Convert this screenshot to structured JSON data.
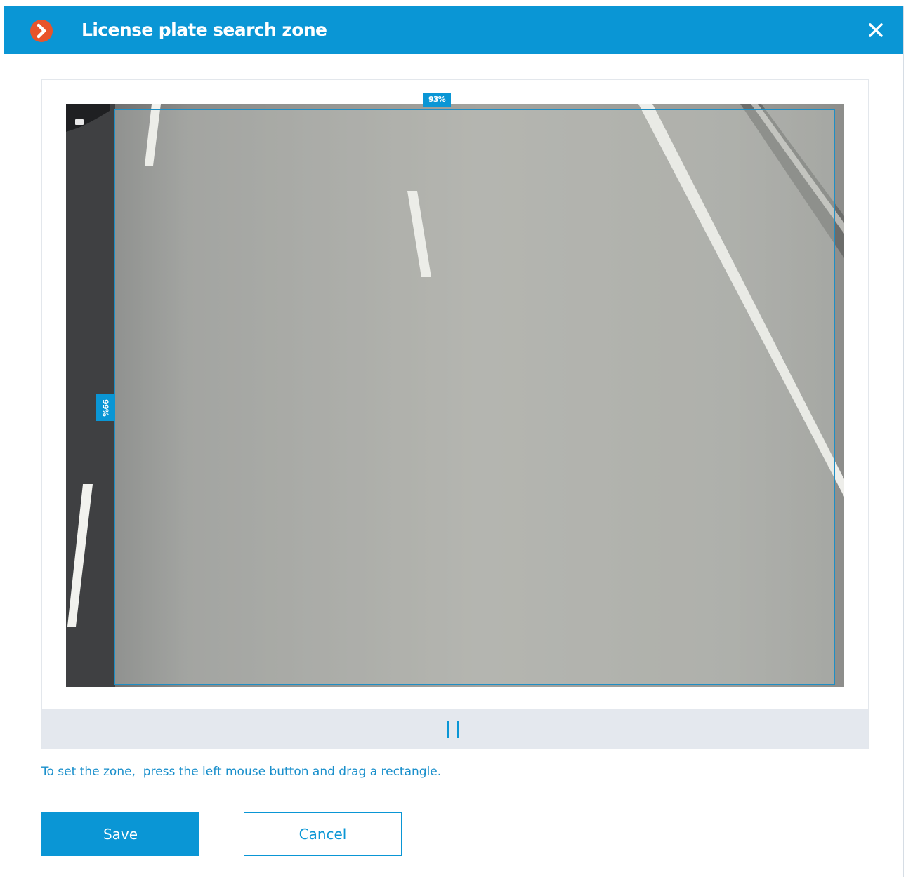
{
  "dialog": {
    "title": "License plate search zone",
    "logo_icon": "chevron-right-icon",
    "close_icon": "close-icon"
  },
  "zone": {
    "width_label": "93%",
    "height_label": "99%",
    "width_percent": 93,
    "height_percent": 99
  },
  "controls": {
    "pause_icon": "pause-icon"
  },
  "hint": "To set the zone,  press the left mouse button and drag a rectangle.",
  "buttons": {
    "save": "Save",
    "cancel": "Cancel"
  },
  "colors": {
    "accent": "#0a96d5",
    "logo": "#e8542b",
    "zone_border": "#1f8ec4"
  }
}
